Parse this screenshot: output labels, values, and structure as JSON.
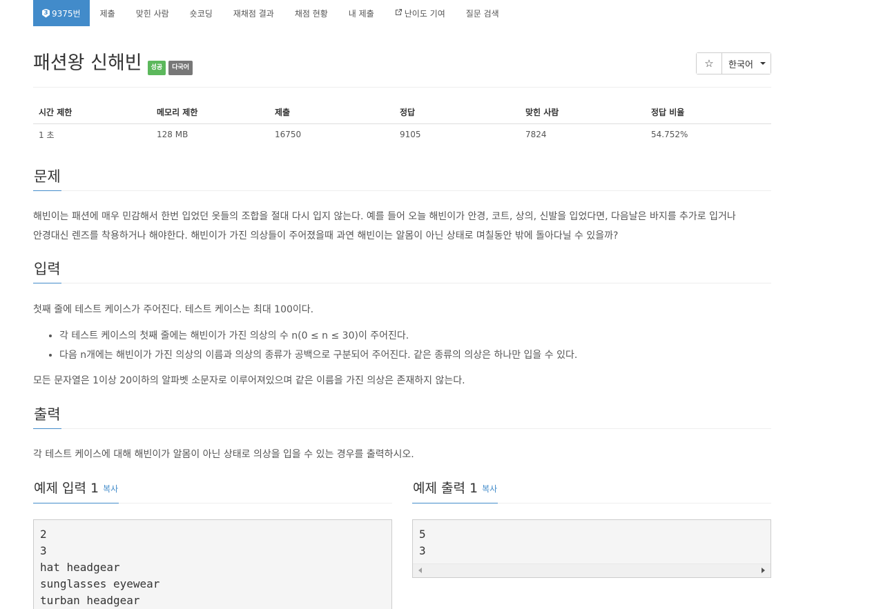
{
  "nav": {
    "problem_tab": {
      "tier_badge": "3",
      "label": "9375번"
    },
    "tabs": [
      "제출",
      "맞힌 사람",
      "숏코딩",
      "재채점 결과",
      "채점 현황",
      "내 제출",
      "난이도 기여",
      "질문 검색"
    ]
  },
  "header": {
    "title": "패션왕 신해빈",
    "badges": [
      "성공",
      "다국어"
    ],
    "star": "☆",
    "language": "한국어"
  },
  "info": {
    "headers": [
      "시간 제한",
      "메모리 제한",
      "제출",
      "정답",
      "맞힌 사람",
      "정답 비율"
    ],
    "values": [
      "1 초",
      "128 MB",
      "16750",
      "9105",
      "7824",
      "54.752%"
    ]
  },
  "problem": {
    "heading": "문제",
    "line1": "해빈이는 패션에 매우 민감해서 한번 입었던 옷들의 조합을 절대 다시 입지 않는다. 예를 들어 오늘 해빈이가 안경, 코트, 상의, 신발을 입었다면, 다음날은 바지를 추가로 입거나",
    "line2": "안경대신 렌즈를 착용하거나 해야한다. 해빈이가 가진 의상들이 주어졌을때 과연 해빈이는 알몸이 아닌 상태로 며칠동안 밖에 돌아다닐 수 있을까?"
  },
  "input": {
    "heading": "입력",
    "intro": "첫째 줄에 테스트 케이스가 주어진다. 테스트 케이스는 최대 100이다.",
    "bullets": [
      "각 테스트 케이스의 첫째 줄에는 해빈이가 가진 의상의 수 n(0 ≤ n ≤ 30)이 주어진다.",
      "다음 n개에는 해빈이가 가진 의상의 이름과 의상의 종류가 공백으로 구분되어 주어진다. 같은 종류의 의상은 하나만 입을 수 있다."
    ],
    "outro": "모든 문자열은 1이상 20이하의 알파벳 소문자로 이루어져있으며 같은 이름을 가진 의상은 존재하지 않는다."
  },
  "output": {
    "heading": "출력",
    "text": "각 테스트 케이스에 대해 해빈이가 알몸이 아닌 상태로 의상을 입을 수 있는 경우를 출력하시오."
  },
  "samples": {
    "input_title": "예제 입력 1",
    "output_title": "예제 출력 1",
    "copy_label": "복사",
    "input_lines": [
      "2",
      "3",
      "hat headgear",
      "sunglasses eyewear",
      "turban headgear"
    ],
    "output_lines": [
      "5",
      "3"
    ]
  },
  "colors": {
    "accent": "#428bca",
    "success": "#5cb85c",
    "default_label": "#777777"
  }
}
